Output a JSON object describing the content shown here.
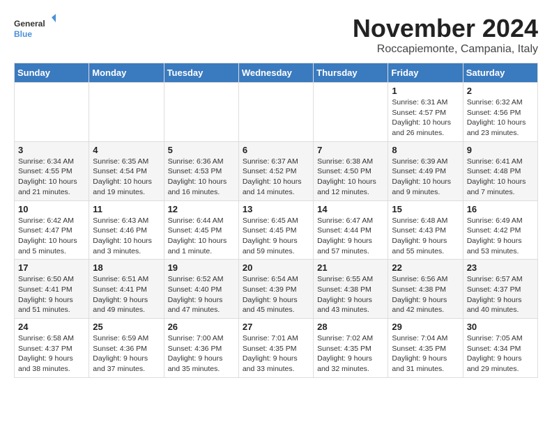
{
  "logo": {
    "general": "General",
    "blue": "Blue"
  },
  "header": {
    "month": "November 2024",
    "location": "Roccapiemonte, Campania, Italy"
  },
  "weekdays": [
    "Sunday",
    "Monday",
    "Tuesday",
    "Wednesday",
    "Thursday",
    "Friday",
    "Saturday"
  ],
  "weeks": [
    [
      {
        "day": "",
        "info": ""
      },
      {
        "day": "",
        "info": ""
      },
      {
        "day": "",
        "info": ""
      },
      {
        "day": "",
        "info": ""
      },
      {
        "day": "",
        "info": ""
      },
      {
        "day": "1",
        "info": "Sunrise: 6:31 AM\nSunset: 4:57 PM\nDaylight: 10 hours and 26 minutes."
      },
      {
        "day": "2",
        "info": "Sunrise: 6:32 AM\nSunset: 4:56 PM\nDaylight: 10 hours and 23 minutes."
      }
    ],
    [
      {
        "day": "3",
        "info": "Sunrise: 6:34 AM\nSunset: 4:55 PM\nDaylight: 10 hours and 21 minutes."
      },
      {
        "day": "4",
        "info": "Sunrise: 6:35 AM\nSunset: 4:54 PM\nDaylight: 10 hours and 19 minutes."
      },
      {
        "day": "5",
        "info": "Sunrise: 6:36 AM\nSunset: 4:53 PM\nDaylight: 10 hours and 16 minutes."
      },
      {
        "day": "6",
        "info": "Sunrise: 6:37 AM\nSunset: 4:52 PM\nDaylight: 10 hours and 14 minutes."
      },
      {
        "day": "7",
        "info": "Sunrise: 6:38 AM\nSunset: 4:50 PM\nDaylight: 10 hours and 12 minutes."
      },
      {
        "day": "8",
        "info": "Sunrise: 6:39 AM\nSunset: 4:49 PM\nDaylight: 10 hours and 9 minutes."
      },
      {
        "day": "9",
        "info": "Sunrise: 6:41 AM\nSunset: 4:48 PM\nDaylight: 10 hours and 7 minutes."
      }
    ],
    [
      {
        "day": "10",
        "info": "Sunrise: 6:42 AM\nSunset: 4:47 PM\nDaylight: 10 hours and 5 minutes."
      },
      {
        "day": "11",
        "info": "Sunrise: 6:43 AM\nSunset: 4:46 PM\nDaylight: 10 hours and 3 minutes."
      },
      {
        "day": "12",
        "info": "Sunrise: 6:44 AM\nSunset: 4:45 PM\nDaylight: 10 hours and 1 minute."
      },
      {
        "day": "13",
        "info": "Sunrise: 6:45 AM\nSunset: 4:45 PM\nDaylight: 9 hours and 59 minutes."
      },
      {
        "day": "14",
        "info": "Sunrise: 6:47 AM\nSunset: 4:44 PM\nDaylight: 9 hours and 57 minutes."
      },
      {
        "day": "15",
        "info": "Sunrise: 6:48 AM\nSunset: 4:43 PM\nDaylight: 9 hours and 55 minutes."
      },
      {
        "day": "16",
        "info": "Sunrise: 6:49 AM\nSunset: 4:42 PM\nDaylight: 9 hours and 53 minutes."
      }
    ],
    [
      {
        "day": "17",
        "info": "Sunrise: 6:50 AM\nSunset: 4:41 PM\nDaylight: 9 hours and 51 minutes."
      },
      {
        "day": "18",
        "info": "Sunrise: 6:51 AM\nSunset: 4:41 PM\nDaylight: 9 hours and 49 minutes."
      },
      {
        "day": "19",
        "info": "Sunrise: 6:52 AM\nSunset: 4:40 PM\nDaylight: 9 hours and 47 minutes."
      },
      {
        "day": "20",
        "info": "Sunrise: 6:54 AM\nSunset: 4:39 PM\nDaylight: 9 hours and 45 minutes."
      },
      {
        "day": "21",
        "info": "Sunrise: 6:55 AM\nSunset: 4:38 PM\nDaylight: 9 hours and 43 minutes."
      },
      {
        "day": "22",
        "info": "Sunrise: 6:56 AM\nSunset: 4:38 PM\nDaylight: 9 hours and 42 minutes."
      },
      {
        "day": "23",
        "info": "Sunrise: 6:57 AM\nSunset: 4:37 PM\nDaylight: 9 hours and 40 minutes."
      }
    ],
    [
      {
        "day": "24",
        "info": "Sunrise: 6:58 AM\nSunset: 4:37 PM\nDaylight: 9 hours and 38 minutes."
      },
      {
        "day": "25",
        "info": "Sunrise: 6:59 AM\nSunset: 4:36 PM\nDaylight: 9 hours and 37 minutes."
      },
      {
        "day": "26",
        "info": "Sunrise: 7:00 AM\nSunset: 4:36 PM\nDaylight: 9 hours and 35 minutes."
      },
      {
        "day": "27",
        "info": "Sunrise: 7:01 AM\nSunset: 4:35 PM\nDaylight: 9 hours and 33 minutes."
      },
      {
        "day": "28",
        "info": "Sunrise: 7:02 AM\nSunset: 4:35 PM\nDaylight: 9 hours and 32 minutes."
      },
      {
        "day": "29",
        "info": "Sunrise: 7:04 AM\nSunset: 4:35 PM\nDaylight: 9 hours and 31 minutes."
      },
      {
        "day": "30",
        "info": "Sunrise: 7:05 AM\nSunset: 4:34 PM\nDaylight: 9 hours and 29 minutes."
      }
    ]
  ]
}
